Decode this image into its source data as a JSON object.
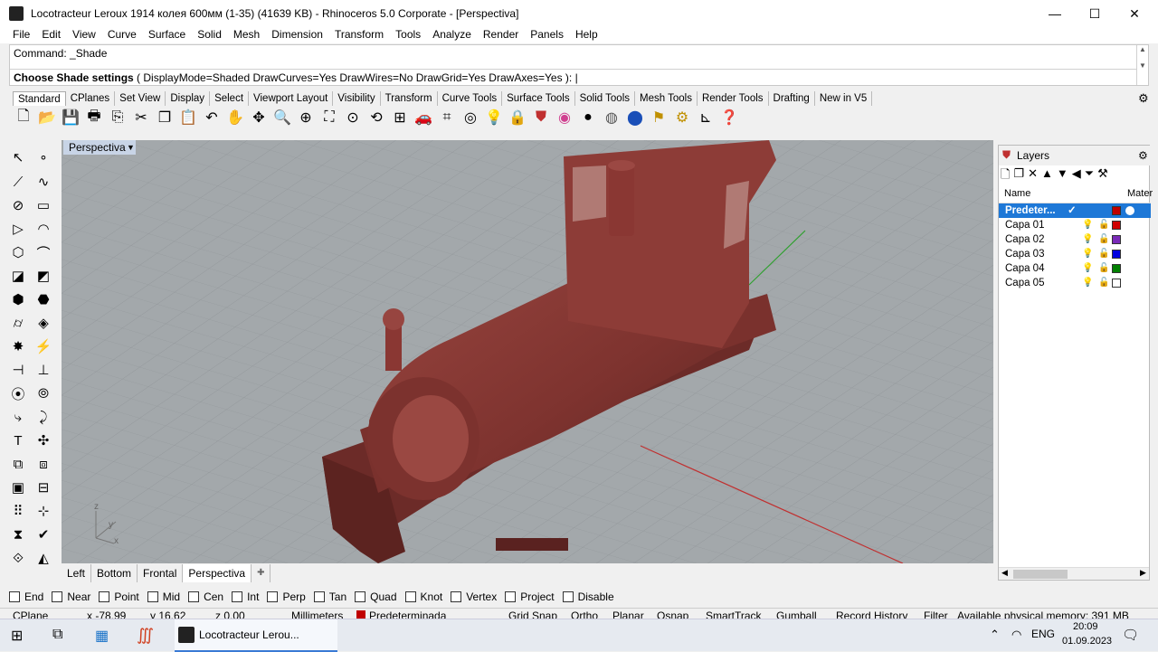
{
  "window": {
    "title": "Locotracteur Leroux 1914 колея 600мм (1-35) (41639 KB) - Rhinoceros  5.0 Corporate - [Perspectiva]",
    "minimize": "—",
    "maximize": "☐",
    "close": "✕"
  },
  "menu": [
    "File",
    "Edit",
    "View",
    "Curve",
    "Surface",
    "Solid",
    "Mesh",
    "Dimension",
    "Transform",
    "Tools",
    "Analyze",
    "Render",
    "Panels",
    "Help"
  ],
  "command": {
    "history": "Command: _Shade",
    "prompt": "Choose Shade settings",
    "options": " ( DisplayMode=Shaded  DrawCurves=Yes  DrawWires=No  DrawGrid=Yes  DrawAxes=Yes ):"
  },
  "toolbar_tabs": [
    "Standard",
    "CPlanes",
    "Set View",
    "Display",
    "Select",
    "Viewport Layout",
    "Visibility",
    "Transform",
    "Curve Tools",
    "Surface Tools",
    "Solid Tools",
    "Mesh Tools",
    "Render Tools",
    "Drafting",
    "New in V5"
  ],
  "toolbar_icons": [
    "new-icon",
    "open-icon",
    "save-icon",
    "print-icon",
    "import-icon",
    "cut-icon",
    "copy-icon",
    "paste-icon",
    "undo-icon",
    "pan-icon",
    "move-view-icon",
    "zoom-icon",
    "zoom-window-icon",
    "zoom-extents-icon",
    "zoom-selected-icon",
    "rotate-view-icon",
    "four-view-icon",
    "car-icon",
    "grid-snap-icon",
    "point-icon",
    "light-icon",
    "lock-icon",
    "shield-icon",
    "color-wheel-icon",
    "shade-icon",
    "render-icon",
    "sphere-icon",
    "flag-icon",
    "gear-icon",
    "dimension-icon",
    "help-icon"
  ],
  "viewport": {
    "name": "Perspectiva",
    "axes": {
      "x": "x",
      "y": "y",
      "z": "z"
    }
  },
  "view_tabs": [
    "Left",
    "Bottom",
    "Frontal",
    "Perspectiva"
  ],
  "view_tab_add": "✚",
  "layers": {
    "title": "Layers",
    "col_name": "Name",
    "col_material": "Mater",
    "items": [
      {
        "name": "Predeter...",
        "current": "✓",
        "color": "#c00000"
      },
      {
        "name": "Capa 01",
        "color": "#d00000"
      },
      {
        "name": "Capa 02",
        "color": "#7a2ab8"
      },
      {
        "name": "Capa 03",
        "color": "#0000e0"
      },
      {
        "name": "Capa 04",
        "color": "#008000"
      },
      {
        "name": "Capa 05",
        "color": "#ffffff"
      }
    ]
  },
  "osnaps": [
    "End",
    "Near",
    "Point",
    "Mid",
    "Cen",
    "Int",
    "Perp",
    "Tan",
    "Quad",
    "Knot",
    "Vertex",
    "Project",
    "Disable"
  ],
  "status": {
    "cplane": "CPlane",
    "x": "x -78.99",
    "y": "y 16.62",
    "z": "z 0.00",
    "units": "Millimeters",
    "layer": "Predeterminada",
    "grid_snap": "Grid Snap",
    "ortho": "Ortho",
    "planar": "Planar",
    "osnap": "Osnap",
    "smarttrack": "SmartTrack",
    "gumball": "Gumball",
    "record_history": "Record History",
    "filter": "Filter",
    "memory": "Available physical memory: 391 MB"
  },
  "taskbar": {
    "app_label": "Locotracteur Lerou...",
    "lang": "ENG",
    "time": "20:09",
    "date": "01.09.2023"
  },
  "colors": {
    "model": "#8a3a36",
    "viewport_bg": "#9ea3a6",
    "selection": "#1e78d7"
  }
}
